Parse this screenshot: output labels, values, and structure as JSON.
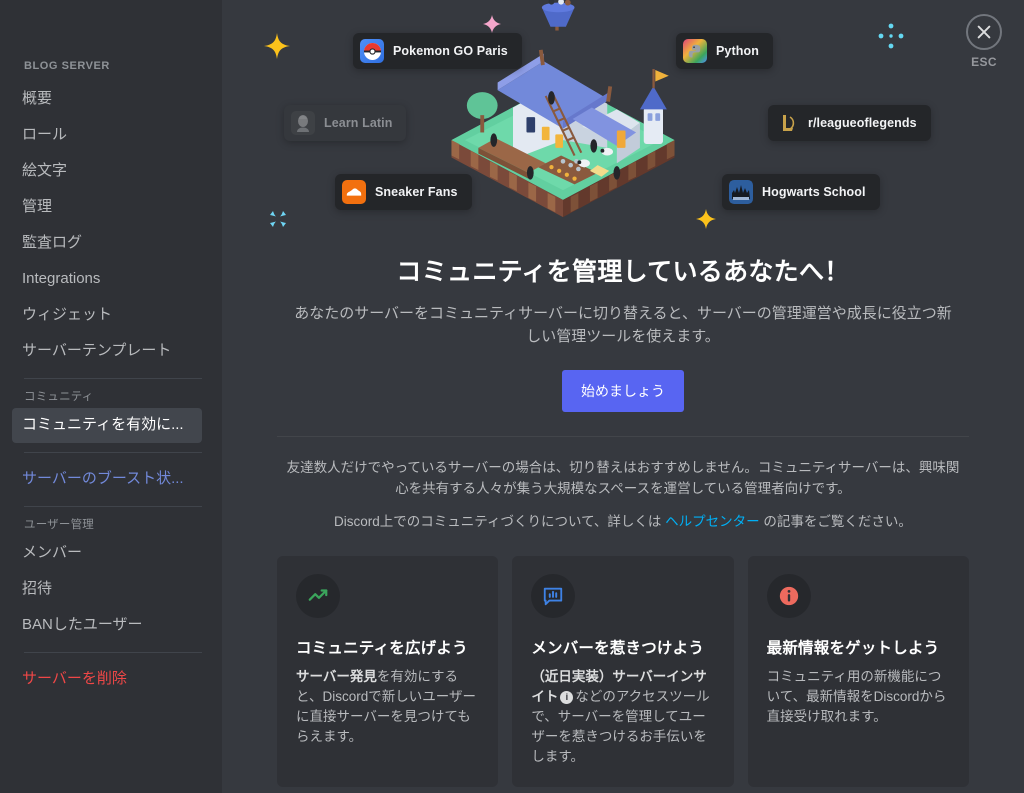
{
  "sidebar": {
    "header": "BLOG SERVER",
    "groups": [
      {
        "label": null,
        "items": [
          {
            "label": "概要",
            "state": "normal"
          },
          {
            "label": "ロール",
            "state": "normal"
          },
          {
            "label": "絵文字",
            "state": "normal"
          },
          {
            "label": "管理",
            "state": "normal"
          },
          {
            "label": "監査ログ",
            "state": "normal"
          },
          {
            "label": "Integrations",
            "state": "normal"
          },
          {
            "label": "ウィジェット",
            "state": "normal"
          },
          {
            "label": "サーバーテンプレート",
            "state": "normal"
          }
        ]
      },
      {
        "label": "コミュニティ",
        "items": [
          {
            "label": "コミュニティを有効に...",
            "state": "active"
          }
        ]
      },
      {
        "label": null,
        "items": [
          {
            "label": "サーバーのブースト状...",
            "state": "link"
          }
        ]
      },
      {
        "label": "ユーザー管理",
        "items": [
          {
            "label": "メンバー",
            "state": "normal"
          },
          {
            "label": "招待",
            "state": "normal"
          },
          {
            "label": "BANしたユーザー",
            "state": "normal"
          }
        ]
      },
      {
        "label": null,
        "items": [
          {
            "label": "サーバーを削除",
            "state": "danger"
          }
        ]
      }
    ]
  },
  "close": {
    "icon": "close-icon",
    "label": "ESC"
  },
  "hero": {
    "illustration_name": "isometric-village-illustration",
    "pills": [
      {
        "label": "Pokemon GO Paris",
        "icon": "pokemon-go-icon",
        "dim": false
      },
      {
        "label": "Learn Latin",
        "icon": "latin-bust-icon",
        "dim": true
      },
      {
        "label": "Sneaker Fans",
        "icon": "sneaker-icon",
        "dim": false
      },
      {
        "label": "Python",
        "icon": "python-icon",
        "dim": false
      },
      {
        "label": "r/leagueoflegends",
        "icon": "league-of-legends-icon",
        "dim": false
      },
      {
        "label": "Hogwarts School",
        "icon": "hogwarts-icon",
        "dim": false
      }
    ]
  },
  "main": {
    "headline": "コミュニティを管理しているあなたへ！",
    "subline": "あなたのサーバーをコミュニティサーバーに切り替えると、サーバーの管理運営や成長に役立つ新しい管理ツールを使えます。",
    "cta_label": "始めましょう",
    "note_line1": "友達数人だけでやっているサーバーの場合は、切り替えはおすすめしません。コミュニティサーバーは、興味関心を共有する人々が集う大規模なスペースを運営している管理者向けです。",
    "note_line2_before": "Discord上でのコミュニティづくりについて、詳しくは ",
    "note_link": "ヘルプセンター",
    "note_line2_after": " の記事をご覧ください。"
  },
  "cards": [
    {
      "icon": "trending-up-icon",
      "icon_color": "#3ba55c",
      "title": "コミュニティを広げよう",
      "body_bold": "サーバー発見",
      "body_rest": "を有効にすると、Discordで新しいユーザーに直接サーバーを見つけてもらえます。"
    },
    {
      "icon": "insights-chat-icon",
      "icon_color": "#3e82e5",
      "title": "メンバーを惹きつけよう",
      "body_bold": "（近日実装）サーバーインサイト",
      "body_rest": "などのアクセスツールで、サーバーを管理してユーザーを惹きつけるお手伝いをします。",
      "has_info_badge": true
    },
    {
      "icon": "info-circle-icon",
      "icon_color": "#ed6a5e",
      "title": "最新情報をゲットしよう",
      "body_bold": "",
      "body_rest": "コミュニティ用の新機能について、最新情報をDiscordから直接受け取れます。"
    }
  ],
  "colors": {
    "sidebar_bg": "#2f3136",
    "content_bg": "#36393f",
    "accent_blurple": "#5865f2",
    "link_blue": "#00aff4",
    "danger_red": "#f04747",
    "boost_link": "#7289da"
  }
}
